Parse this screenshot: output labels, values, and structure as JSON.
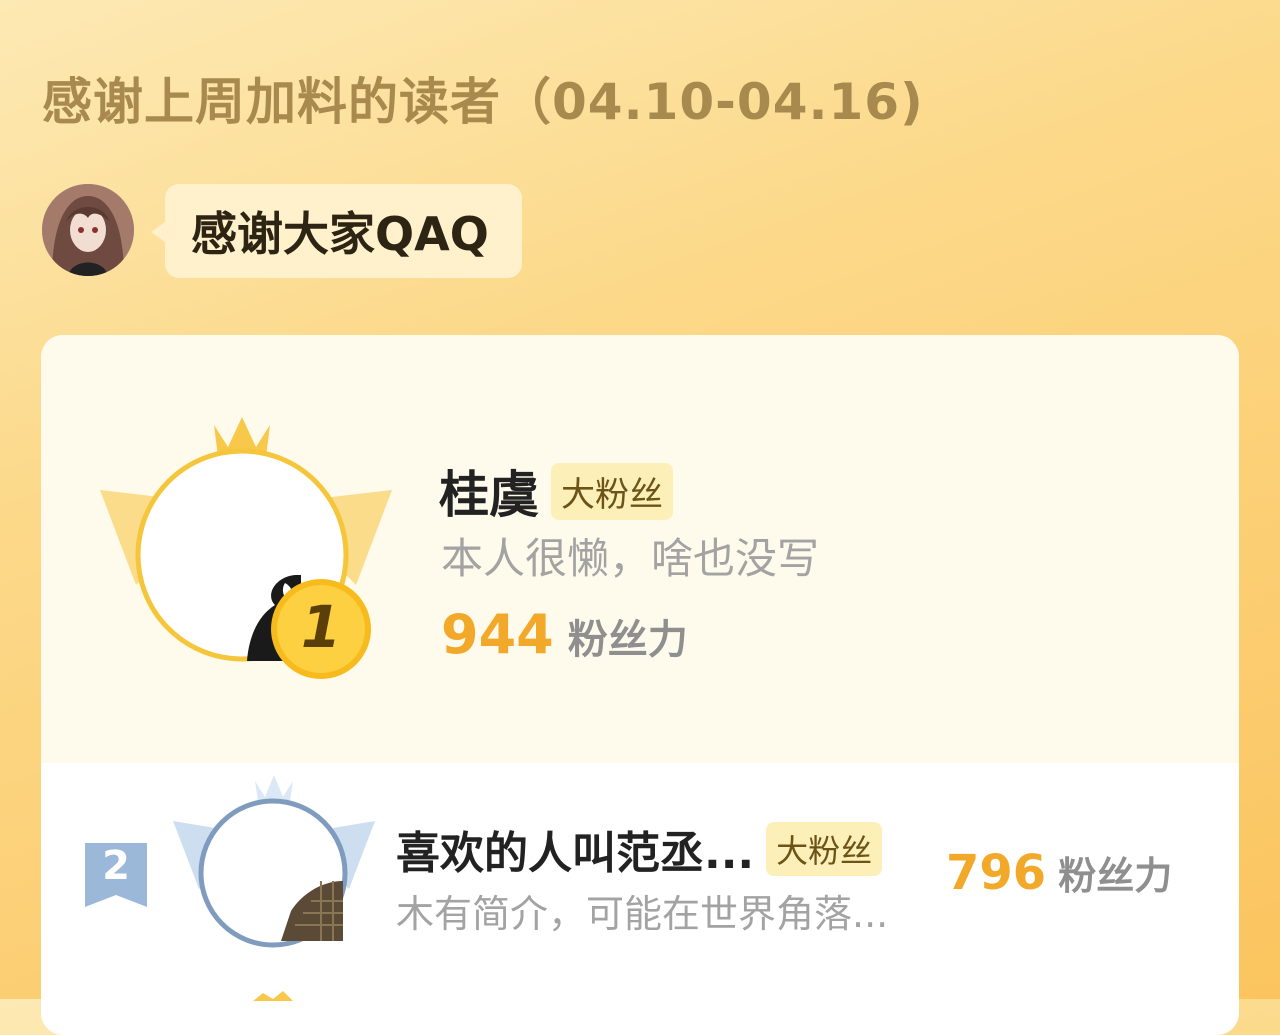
{
  "header": {
    "title": "感谢上周加料的读者（04.10-04.16)"
  },
  "author_message": {
    "avatar_icon": "author-avatar",
    "text": "感谢大家QAQ"
  },
  "ranking": [
    {
      "rank": "1",
      "name": "桂虞",
      "badge": "大粉丝",
      "bio": "本人很懒，啥也没写",
      "fan_power": "944",
      "fan_power_label": "粉丝力",
      "emblem_color": "#f7c84a"
    },
    {
      "rank": "2",
      "name": "喜欢的人叫范丞...",
      "badge": "大粉丝",
      "bio": "木有简介，可能在世界角落...",
      "fan_power": "796",
      "fan_power_label": "粉丝力",
      "emblem_color": "#8fa9c8"
    }
  ],
  "colors": {
    "accent": "#f2a92a",
    "badge_bg": "#fcefb8",
    "title": "#a88a4e"
  }
}
